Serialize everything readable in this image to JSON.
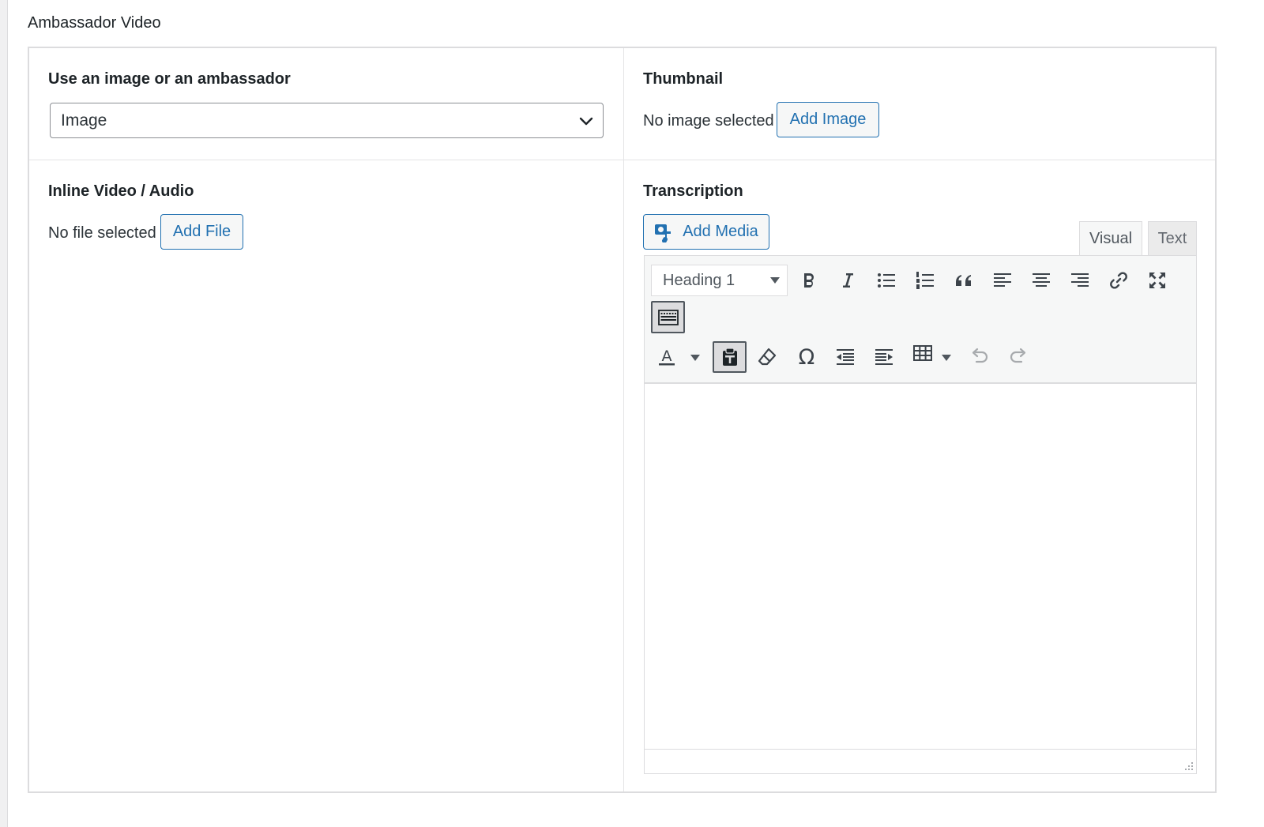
{
  "section": {
    "title": "Ambassador Video"
  },
  "image_or_ambassador": {
    "label": "Use an image or an ambassador",
    "selected": "Image"
  },
  "thumbnail": {
    "label": "Thumbnail",
    "status": "No image selected",
    "button": "Add Image"
  },
  "inline_media": {
    "label": "Inline Video / Audio",
    "status": "No file selected",
    "button": "Add File"
  },
  "transcription": {
    "label": "Transcription",
    "add_media": "Add Media",
    "tabs": [
      {
        "label": "Visual",
        "active": true
      },
      {
        "label": "Text",
        "active": false
      }
    ],
    "format_select": "Heading 1",
    "toolbar_row1": [
      "bold-icon",
      "italic-icon",
      "bulleted-list-icon",
      "numbered-list-icon",
      "blockquote-icon",
      "align-left-icon",
      "align-center-icon",
      "align-right-icon",
      "link-icon",
      "fullscreen-icon",
      "toolbar-toggle-icon"
    ],
    "toolbar_row2": [
      "text-color-icon",
      "paste-as-text-icon",
      "clear-formatting-icon",
      "special-character-icon",
      "outdent-icon",
      "indent-icon",
      "table-icon",
      "undo-icon",
      "redo-icon"
    ],
    "special_char_glyph": "Ω",
    "text_color_glyph": "A",
    "content": ""
  },
  "colors": {
    "accent": "#2271b1",
    "border": "#dcdcde",
    "text": "#1d2327",
    "toolbar_bg": "#f6f7f7"
  }
}
